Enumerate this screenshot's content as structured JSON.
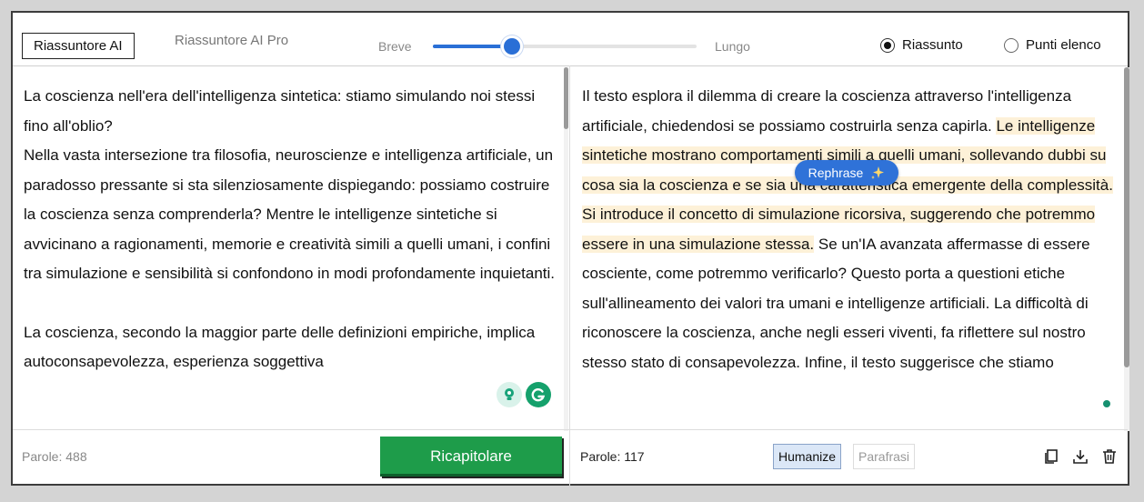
{
  "header": {
    "tabs": [
      {
        "label": "Riassuntore AI",
        "active": true
      },
      {
        "label": "Riassuntore AI Pro",
        "active": false
      }
    ],
    "slider": {
      "min_label": "Breve",
      "max_label": "Lungo",
      "value": 0.3
    },
    "format_options": [
      {
        "label": "Riassunto",
        "selected": true
      },
      {
        "label": "Punti elenco",
        "selected": false
      }
    ]
  },
  "input": {
    "paragraphs": [
      "La coscienza nell'era dell'intelligenza sintetica: stiamo simulando noi stessi fino all'oblio?",
      "Nella vasta intersezione tra filosofia, neuroscienze e intelligenza artificiale, un paradosso pressante si sta silenziosamente dispiegando: possiamo costruire la coscienza senza comprenderla? Mentre le intelligenze sintetiche si avvicinano a ragionamenti, memorie e creatività simili a quelli umani, i confini tra simulazione e sensibilità si confondono in modi profondamente inquietanti.",
      "La coscienza, secondo la maggior parte delle definizioni empiriche, implica autoconsapevolezza, esperienza soggettiva"
    ],
    "word_count_label": "Parole: 488",
    "submit_label": "Ricapitolare"
  },
  "output": {
    "segments": [
      {
        "text": "Il testo esplora il dilemma di creare la coscienza attraverso l'intelligenza artificiale, chiedendosi se possiamo costruirla senza capirla. ",
        "highlight": false
      },
      {
        "text": "Le intelligenze sintetiche mostrano comportamenti simili a quelli umani, sollevando dubbi su cosa sia la coscienza e se sia una caratteristica emergente della complessità.",
        "highlight": true
      },
      {
        "text": " ",
        "highlight": false
      },
      {
        "text": "Si introduce il concetto di simulazione ricorsiva, suggerendo che potremmo essere in una simulazione stessa.",
        "highlight": true
      },
      {
        "text": " Se un'IA avanzata affermasse di essere cosciente, come potremmo verificarlo? Questo porta a questioni etiche sull'allineamento dei valori tra umani e intelligenze artificiali. La difficoltà di riconoscere la coscienza, anche negli esseri viventi, fa riflettere sul nostro stesso stato di consapevolezza. Infine, il testo suggerisce che stiamo",
        "highlight": false
      }
    ],
    "word_count_label": "Parole: 117",
    "humanize_label": "Humanize",
    "paraphrase_label": "Parafrasi",
    "rephrase_label": "Rephrase",
    "icons": [
      "copy-icon",
      "download-icon",
      "trash-icon"
    ]
  },
  "colors": {
    "accent": "#2a6fd6",
    "primary_button": "#1e9c4a",
    "highlight": "#fdf1d8"
  }
}
